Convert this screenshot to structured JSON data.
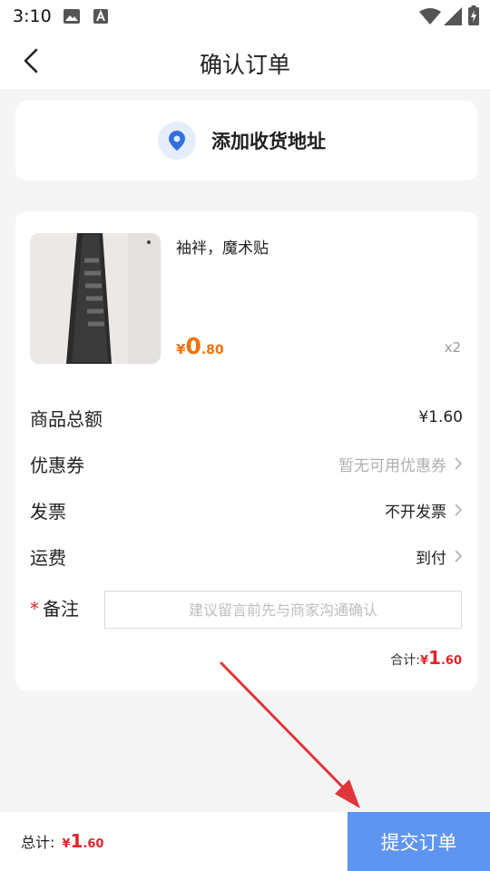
{
  "status_bar": {
    "time": "3:10",
    "icons": [
      "image-icon",
      "a-icon",
      "wifi-icon",
      "signal-icon",
      "battery-icon"
    ]
  },
  "nav": {
    "title": "确认订单",
    "back_icon": "chevron-left-icon"
  },
  "address": {
    "label": "添加收货地址",
    "icon": "location-pin-icon",
    "icon_color": "#2f6fe0"
  },
  "product": {
    "name": "袖袢，魔术贴",
    "price_symbol": "¥",
    "price_int": "0",
    "price_dec": ".80",
    "quantity": "x2",
    "price_color": "#f0720b"
  },
  "rows": {
    "goods_total": {
      "label": "商品总额",
      "value": "¥1.60"
    },
    "coupon": {
      "label": "优惠券",
      "value": "暂无可用优惠券"
    },
    "invoice": {
      "label": "发票",
      "value": "不开发票"
    },
    "shipping": {
      "label": "运费",
      "value": "到付"
    }
  },
  "remark": {
    "star": "*",
    "label": "备注",
    "placeholder": "建议留言前先与商家沟通确认",
    "value": ""
  },
  "subtotal": {
    "label": "合计:",
    "symbol": "¥",
    "int": "1",
    "dec": ".60"
  },
  "footer": {
    "total_label": "总计:",
    "symbol": "¥",
    "int": "1",
    "dec": ".60",
    "submit_label": "提交订单",
    "submit_color": "#5e95f0"
  },
  "annotation": {
    "arrow_color": "#e0353a"
  }
}
